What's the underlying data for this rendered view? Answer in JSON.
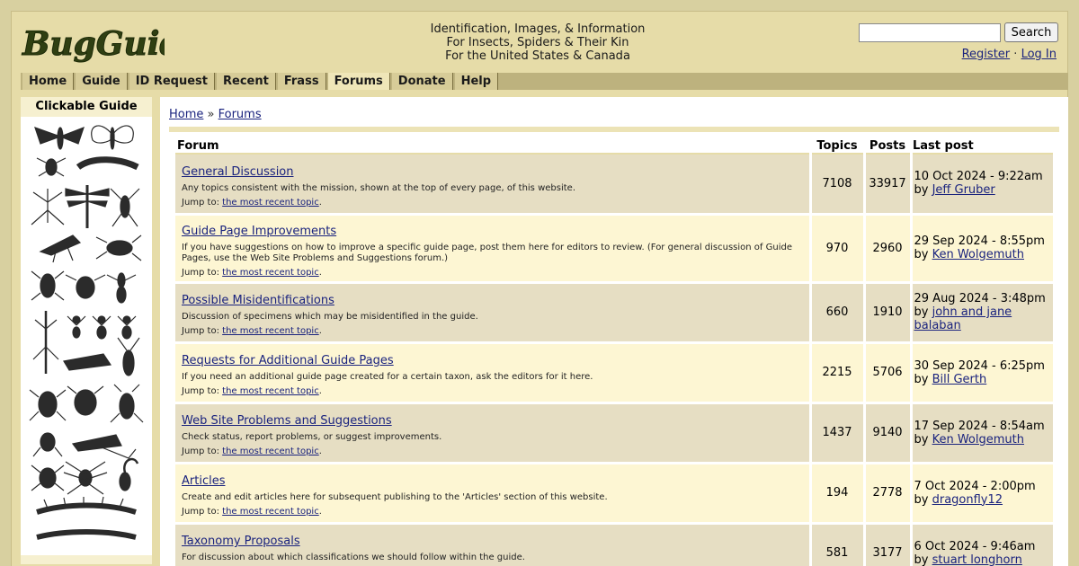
{
  "header": {
    "logo_text": "BugGuide",
    "tagline": [
      "Identification, Images, & Information",
      "For Insects, Spiders & Their Kin",
      "For the United States & Canada"
    ],
    "search": {
      "value": "",
      "button_label": "Search"
    },
    "register_label": "Register",
    "separator": "·",
    "login_label": "Log In"
  },
  "nav": {
    "items": [
      "Home",
      "Guide",
      "ID Request",
      "Recent",
      "Frass",
      "Forums",
      "Donate",
      "Help"
    ],
    "active": "Forums"
  },
  "sidebar": {
    "title": "Clickable Guide"
  },
  "breadcrumb": {
    "home": "Home",
    "sep": " » ",
    "current": "Forums"
  },
  "table": {
    "headers": {
      "forum": "Forum",
      "topics": "Topics",
      "posts": "Posts",
      "last_post": "Last post"
    },
    "jump_label": "Jump to:",
    "jump_link": "the most recent topic",
    "rows": [
      {
        "title": "General Discussion",
        "desc": "Any topics consistent with the mission, shown at the top of every page, of this website.",
        "topics": "7108",
        "posts": "33917",
        "last_date": "10 Oct 2024 - 9:22am",
        "by": "by",
        "last_user": "Jeff Gruber"
      },
      {
        "title": "Guide Page Improvements",
        "desc": "If you have suggestions on how to improve a specific guide page, post them here for editors to review. (For general discussion of Guide Pages, use the Web Site Problems and Suggestions forum.)",
        "topics": "970",
        "posts": "2960",
        "last_date": "29 Sep 2024 - 8:55pm",
        "by": "by",
        "last_user": "Ken Wolgemuth"
      },
      {
        "title": "Possible Misidentifications",
        "desc": "Discussion of specimens which may be misidentified in the guide.",
        "topics": "660",
        "posts": "1910",
        "last_date": "29 Aug 2024 - 3:48pm",
        "by": "by",
        "last_user": "john and jane balaban"
      },
      {
        "title": "Requests for Additional Guide Pages",
        "desc": "If you need an additional guide page created for a certain taxon, ask the editors for it here.",
        "topics": "2215",
        "posts": "5706",
        "last_date": "30 Sep 2024 - 6:25pm",
        "by": "by",
        "last_user": "Bill Gerth"
      },
      {
        "title": "Web Site Problems and Suggestions",
        "desc": "Check status, report problems, or suggest improvements.",
        "topics": "1437",
        "posts": "9140",
        "last_date": "17 Sep 2024 - 8:54am",
        "by": "by",
        "last_user": "Ken Wolgemuth"
      },
      {
        "title": "Articles",
        "desc": "Create and edit articles here for subsequent publishing to the 'Articles' section of this website.",
        "topics": "194",
        "posts": "2778",
        "last_date": "7 Oct 2024 - 2:00pm",
        "by": "by",
        "last_user": "dragonfly12"
      },
      {
        "title": "Taxonomy Proposals",
        "desc": "For discussion about which classifications we should follow within the guide.",
        "topics": "581",
        "posts": "3177",
        "last_date": "6 Oct 2024 - 9:46am",
        "by": "by",
        "last_user": "stuart longhorn"
      }
    ]
  }
}
